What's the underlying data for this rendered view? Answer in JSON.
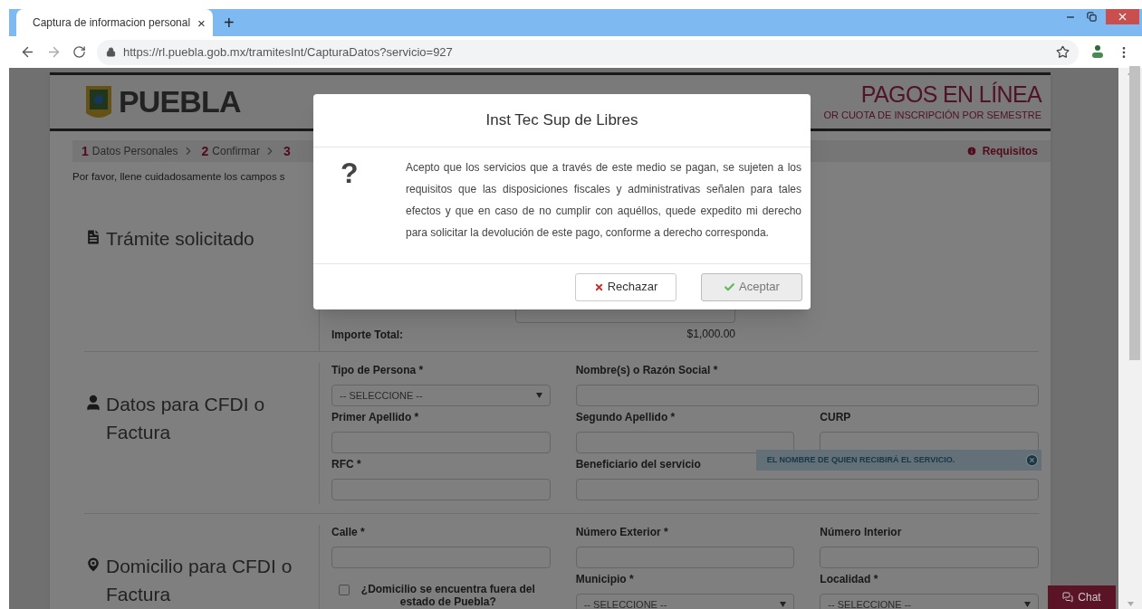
{
  "browser": {
    "tab": {
      "title": "Captura de informacion personal",
      "close": "×"
    },
    "new_tab": "+",
    "address": "https://rl.puebla.gob.mx/tramitesInt/CapturaDatos?servicio=927"
  },
  "header": {
    "brand": "PUEBLA",
    "title": "PAGOS EN LÍNEA",
    "subtitle": "OR CUOTA DE INSCRIPCIÓN POR SEMESTRE"
  },
  "steps": [
    {
      "number": "1",
      "label": "Datos Personales"
    },
    {
      "number": "2",
      "label": "Confirmar"
    },
    {
      "number": "3"
    }
  ],
  "requirements_link": "Requisitos",
  "instructions": "Por favor, llene cuidadosamente los campos s",
  "sections": [
    {
      "kind": "document",
      "title": "Trámite solicitado",
      "rows": [
        {
          "kind": "input"
        },
        {
          "label": "Importe Total:",
          "kind": "text",
          "value": "$1,000.00"
        }
      ]
    },
    {
      "kind": "person",
      "title": "Datos para CFDI o Factura",
      "fields": [
        {
          "label": "Tipo de Persona *",
          "kind": "select",
          "value": "-- SELECCIONE --"
        },
        {
          "label": "Nombre(s) o Razón Social *",
          "kind": "input"
        },
        {
          "label": "Primer Apellido *",
          "kind": "input"
        },
        {
          "label": "Segundo Apellido *",
          "kind": "input"
        },
        {
          "label": "CURP",
          "kind": "input"
        },
        {
          "label": "RFC *",
          "kind": "input"
        },
        {
          "label": "Beneficiario del servicio",
          "kind": "input",
          "tooltip": "EL NOMBRE DE QUIEN RECIBIRÁ EL SERVICIO."
        }
      ]
    },
    {
      "kind": "pin",
      "title": "Domicilio para CFDI o Factura",
      "fields": [
        {
          "label": "Calle *",
          "kind": "input"
        },
        {
          "label": "Número Exterior *",
          "kind": "input"
        },
        {
          "label": "Número Interior",
          "kind": "input"
        },
        {
          "label": "¿Domicilio se encuentra fuera del estado de Puebla?",
          "kind": "checkbox",
          "checked": false
        },
        {
          "label": "Municipio *",
          "kind": "select",
          "value": "-- SELECCIONE --"
        },
        {
          "label": "Localidad *",
          "kind": "select",
          "value": "-- SELECCIONE --"
        }
      ]
    }
  ],
  "chat": "Chat",
  "modal": {
    "title": "Inst Tec Sup de Libres",
    "icon": "?",
    "body": "Acepto que los servicios que a través de este medio se pagan, se sujeten a los requisitos que las disposiciones fiscales y administrativas señalen para tales efectos y que en caso de no cumplir con aquéllos, quede expedito mi derecho para solicitar la devolución de este pago, conforme a derecho corresponda.",
    "buttons": [
      {
        "label": "Rechazar",
        "kind": "reject",
        "disabled": false
      },
      {
        "label": "Aceptar",
        "kind": "accept",
        "disabled": true
      }
    ]
  }
}
